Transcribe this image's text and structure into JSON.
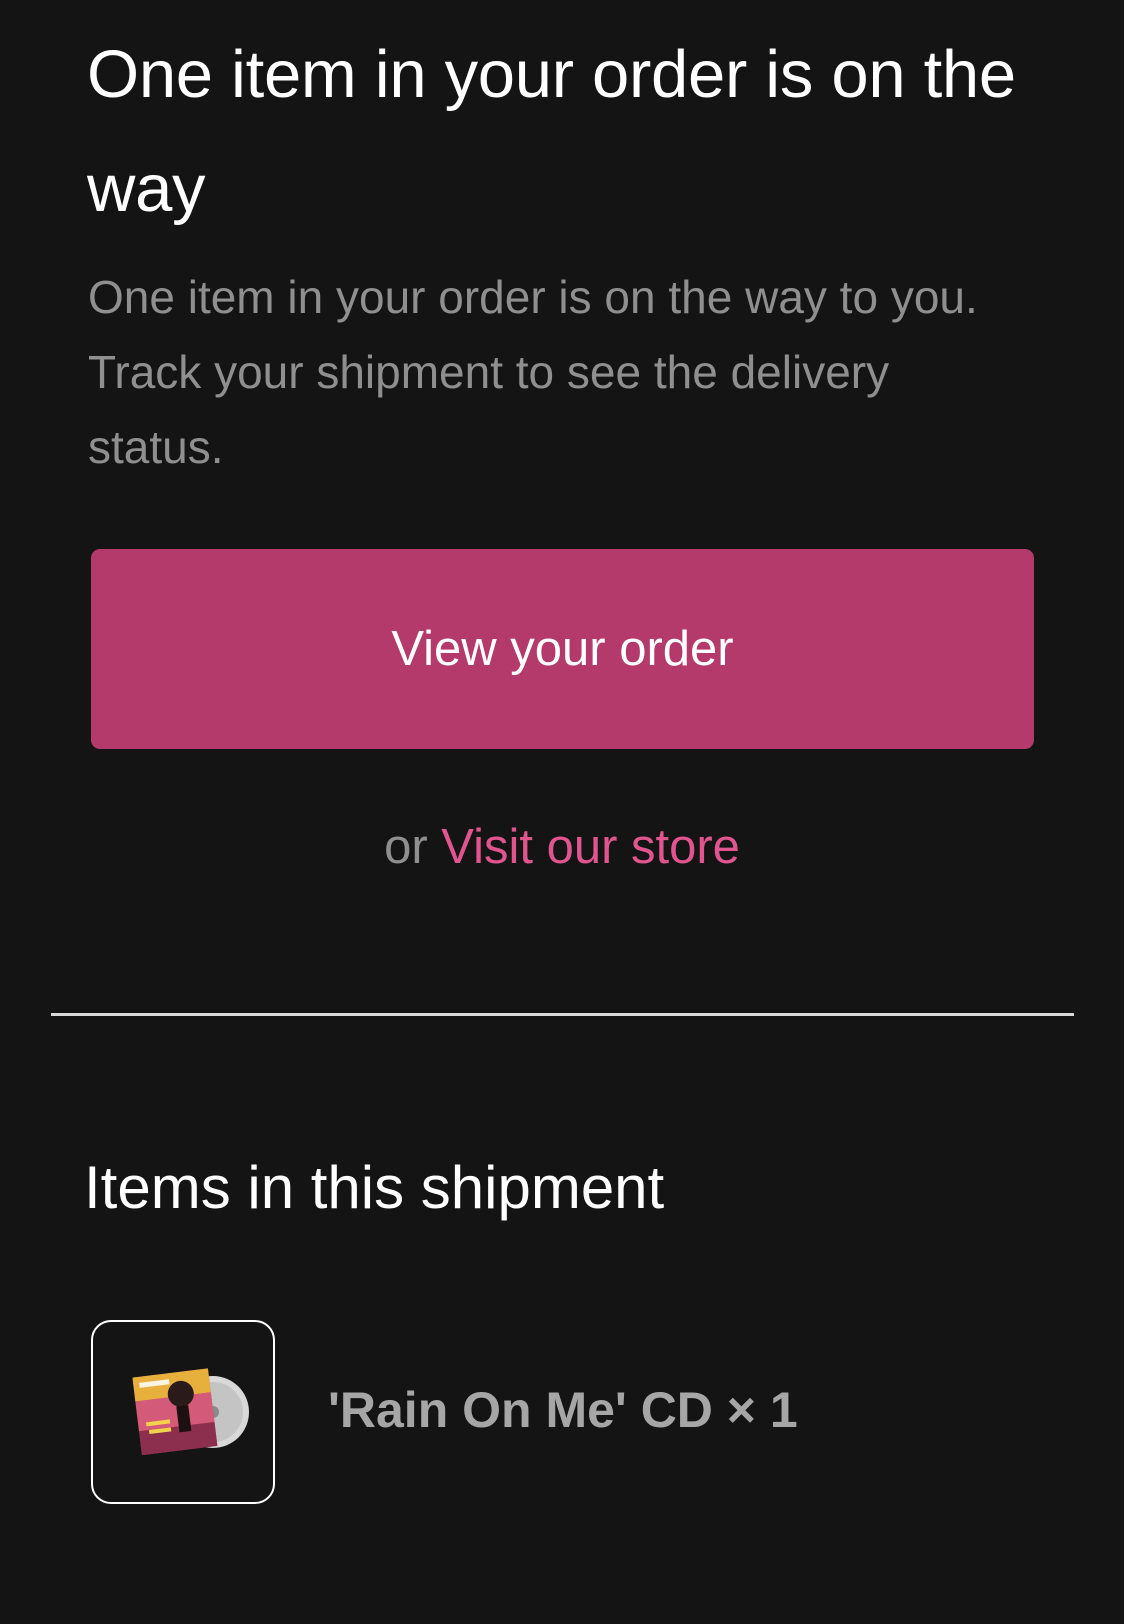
{
  "notification": {
    "heading": "One item in your order is on the way",
    "description": "One item in your order is on the way to you. Track your shipment to see the delivery status."
  },
  "actions": {
    "primary_label": "View your order",
    "secondary_prefix": "or",
    "secondary_link": "Visit our store"
  },
  "shipment": {
    "title": "Items in this shipment",
    "items": [
      {
        "label": "'Rain On Me' CD × 1",
        "image_icon": "album-cd-thumbnail"
      }
    ]
  },
  "colors": {
    "background": "#141414",
    "accent": "#b33a6b",
    "link": "#e0558e"
  }
}
